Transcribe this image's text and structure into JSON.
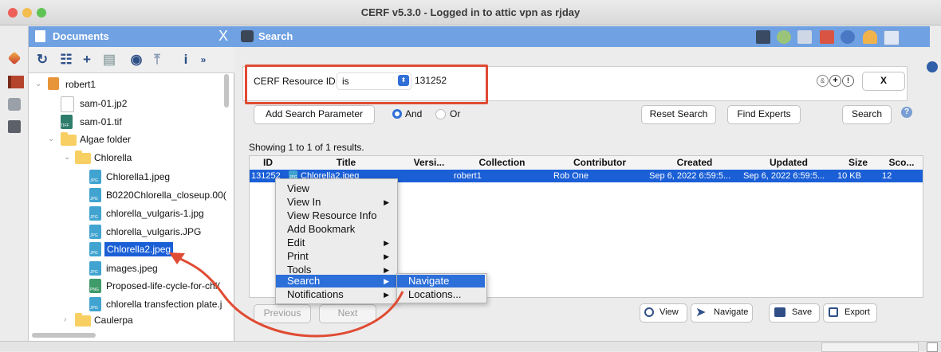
{
  "window": {
    "title": "CERF v5.3.0 - Logged in to attic vpn as rjday"
  },
  "documents_panel": {
    "title": "Documents",
    "close_label": "X",
    "tree": [
      {
        "label": "robert1"
      },
      {
        "label": "sam-01.jp2"
      },
      {
        "label": "sam-01.tif"
      },
      {
        "label": "Algae folder"
      },
      {
        "label": "Chlorella"
      },
      {
        "label": "Chlorella1.jpeg"
      },
      {
        "label": "B0220Chlorella_closeup.00("
      },
      {
        "label": "chlorella_vulgaris-1.jpg"
      },
      {
        "label": "chlorella_vulgaris.JPG"
      },
      {
        "label": "Chlorella2.jpeg"
      },
      {
        "label": "images.jpeg"
      },
      {
        "label": "Proposed-life-cycle-for-chl("
      },
      {
        "label": "chlorella transfection plate.j"
      },
      {
        "label": "Caulerpa"
      }
    ]
  },
  "search_panel": {
    "title": "Search",
    "param": {
      "field": "CERF Resource ID",
      "operator": "is",
      "value": "131252",
      "clear_label": "X"
    },
    "buttons": {
      "add_param": "Add Search Parameter",
      "and": "And",
      "or": "Or",
      "reset": "Reset Search",
      "find_experts": "Find Experts",
      "search": "Search"
    },
    "results_text": "Showing 1 to 1 of 1 results.",
    "table": {
      "columns": [
        "ID",
        "Title",
        "Versi...",
        "Collection",
        "Contributor",
        "Created",
        "Updated",
        "Size",
        "Sco..."
      ],
      "rows": [
        [
          "131252",
          "Chlorella2.jpeg",
          "",
          "robert1",
          "Rob One",
          "Sep 6, 2022 6:59:5...",
          "Sep 6, 2022 6:59:5...",
          "10 KB",
          "12"
        ]
      ]
    },
    "pager": {
      "previous": "Previous",
      "next": "Next"
    },
    "bottom_buttons": {
      "view": "View",
      "navigate": "Navigate",
      "save": "Save",
      "export": "Export"
    }
  },
  "context_menu": {
    "items": [
      {
        "label": "View",
        "submenu": false
      },
      {
        "label": "View In",
        "submenu": true
      },
      {
        "label": "View Resource Info",
        "submenu": false
      },
      {
        "label": "Add Bookmark",
        "submenu": false
      },
      {
        "label": "Edit",
        "submenu": true
      },
      {
        "label": "Print",
        "submenu": true
      },
      {
        "label": "Tools",
        "submenu": true
      },
      {
        "label": "Search",
        "submenu": true
      },
      {
        "label": "Notifications",
        "submenu": true
      }
    ],
    "submenu": [
      {
        "label": "Navigate"
      },
      {
        "label": "Locations..."
      }
    ]
  },
  "colors": {
    "accent": "#6fa1e3",
    "selection": "#1a5fd6",
    "highlight_annotation": "#e04b33",
    "menu_hover": "#2d6fd9"
  }
}
